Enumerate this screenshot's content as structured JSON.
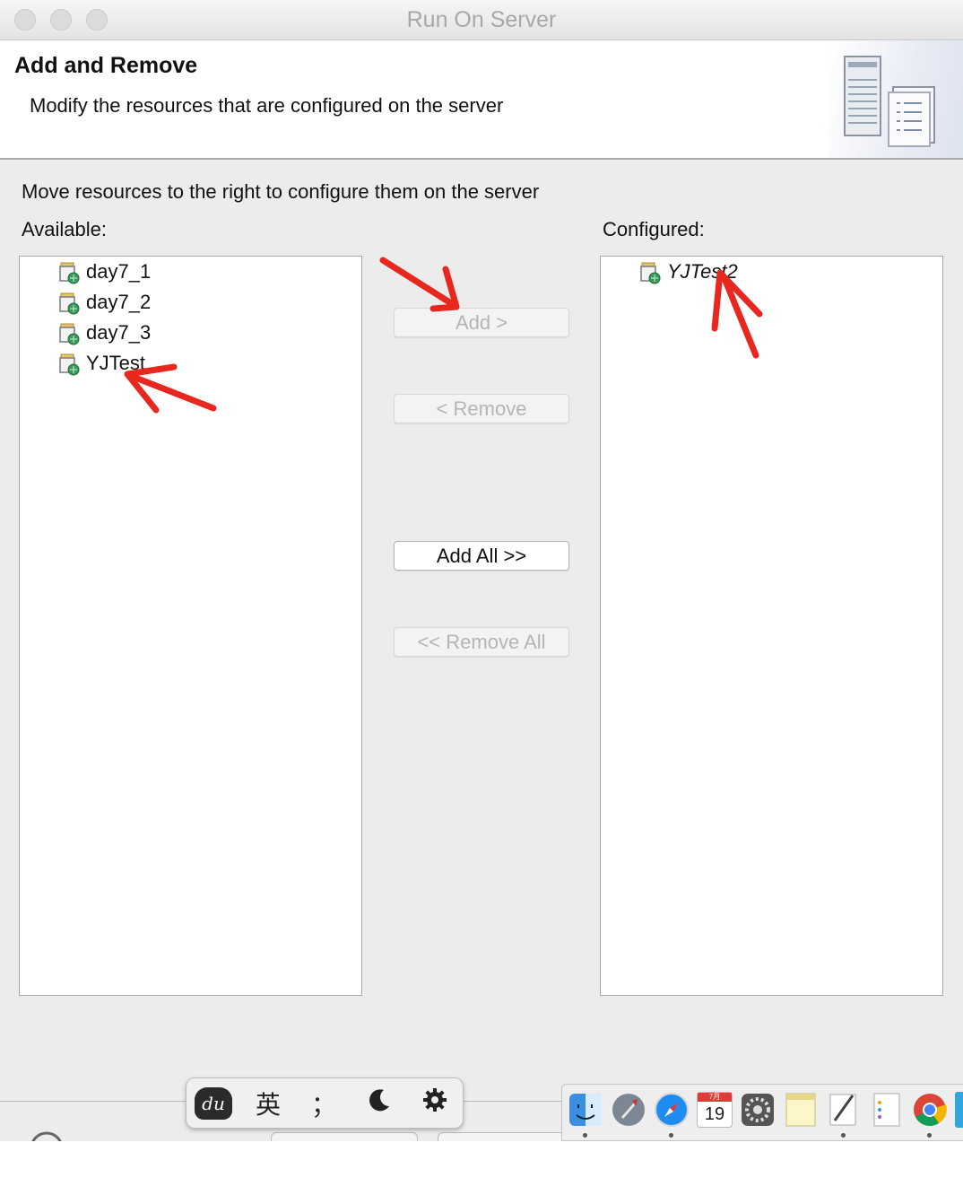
{
  "window": {
    "title": "Run On Server"
  },
  "header": {
    "title": "Add and Remove",
    "description": "Modify the resources that are configured on the server"
  },
  "instruction": "Move resources to the right to configure them on the server",
  "available": {
    "label": "Available:",
    "items": [
      "day7_1",
      "day7_2",
      "day7_3",
      "YJTest"
    ]
  },
  "configured": {
    "label": "Configured:",
    "items": [
      "YJTest2"
    ]
  },
  "buttons": {
    "add": "Add >",
    "remove": "< Remove",
    "add_all": "Add All >>",
    "remove_all": "<< Remove All"
  },
  "ime_toolbar": {
    "logo": "du",
    "language": "英",
    "punctuation": "；",
    "icons": [
      "baidu-du-icon",
      "moon-icon",
      "gear-icon"
    ]
  },
  "dock": {
    "calendar_month": "7月",
    "calendar_day": "19",
    "icons": [
      "finder-icon",
      "launchpad-icon",
      "safari-icon",
      "calendar-icon",
      "system-preferences-icon",
      "notes-icon",
      "textedit-icon",
      "reminders-icon",
      "chrome-icon"
    ]
  },
  "colors": {
    "annotation_arrow": "#e8271e",
    "window_bg": "#ececec",
    "disabled_text": "#b5b5b5"
  }
}
